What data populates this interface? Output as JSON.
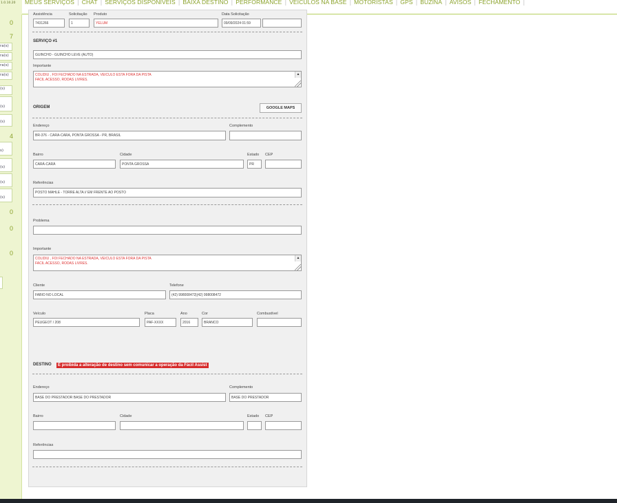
{
  "version": "1.0.10.20",
  "nav": [
    "MEUS SERVIÇOS",
    "CHAT",
    "SERVIÇOS DISPONÍVEIS",
    "BAIXA DESTINO",
    "PERFORMANCE",
    "VEÍCULOS NA BASE",
    "MOTORISTAS",
    "GPS",
    "BUZINA",
    "AVISOS",
    "FECHAMENTO"
  ],
  "left": {
    "counts": [
      "0",
      "7",
      "4",
      "0",
      "0",
      "0"
    ],
    "labels": [
      "ra(s)",
      "ra(s)",
      "ra(s)",
      "ra(s)",
      "(s)",
      "(s)",
      "(s)",
      "s)",
      "(s)",
      "(s)",
      "(s)"
    ]
  },
  "header": {
    "assistencia_label": "Assistência",
    "assistencia_value": "7431266",
    "solicitacao_label": "Solicitação",
    "solicitacao_value": "1",
    "produto_label": "Produto",
    "produto_value": "YELUM",
    "data_label": "Data Solicitação",
    "data_value": "09/09/2024 01:59"
  },
  "servico": {
    "title": "SERVIÇO #1",
    "tipo": "GUINCHO - GUINCHO LEVE (AUTO)",
    "importante_label": "Importante",
    "importante_lines": [
      "COLIDIU , FOI FECHADO NA ESTRADA, VEICULO ESTA FORA DA PISTA",
      "FACIL ACESSO, RODAS LIVRES."
    ]
  },
  "origem": {
    "title": "ORIGEM",
    "maps_button": "GOOGLE MAPS",
    "endereco_label": "Endereço",
    "endereco_value": "BR-376 - CARA-CARA, PONTA GROSSA - PR, BRASIL",
    "complemento_label": "Complemento",
    "complemento_value": "",
    "bairro_label": "Bairro",
    "bairro_value": "CARÁ-CARÁ",
    "cidade_label": "Cidade",
    "cidade_value": "PONTA GROSSA",
    "estado_label": "Estado",
    "estado_value": "PR",
    "cep_label": "CEP",
    "cep_value": "",
    "referencias_label": "Referências",
    "referencias_value": "POSTO MAHLE - TORRE ALTA // EM FRENTE AO POSTO"
  },
  "problema": {
    "problema_label": "Problema",
    "problema_value": "",
    "importante_label": "Importante",
    "importante_lines": [
      "COLIDIU , FOI FECHADO NA ESTRADA, VEICULO ESTA FORA DA PISTA",
      "FACIL ACESSO, RODAS LIVRES."
    ],
    "cliente_label": "Cliente",
    "cliente_value": "FABIO NO LOCAL",
    "telefone_label": "Telefone",
    "telefone_value": "(42) 998008472|(42) 998008472",
    "veiculo_label": "Veículo",
    "veiculo_value": "PEUGEOT / 208",
    "placa_label": "Placa",
    "placa_value": "PAF-XXXX",
    "ano_label": "Ano",
    "ano_value": "2016",
    "cor_label": "Cor",
    "cor_value": "BRANCO",
    "combustivel_label": "Combustível",
    "combustivel_value": ""
  },
  "destino": {
    "title": "DESTINO",
    "warning": "É proibida a alteração de destino sem comunicar a operação da Fácil Assist",
    "endereco_label": "Endereço",
    "endereco_value": "BASE DO PRESTADOR BASE DO PRESTADOR",
    "complemento_label": "Complemento",
    "complemento_value": "BASE DO PRESTADOR",
    "bairro_label": "Bairro",
    "bairro_value": "",
    "cidade_label": "Cidade",
    "cidade_value": "",
    "estado_label": "Estado",
    "estado_value": "",
    "cep_label": "CEP",
    "cep_value": "",
    "referencias_label": "Referências",
    "referencias_value": ""
  }
}
